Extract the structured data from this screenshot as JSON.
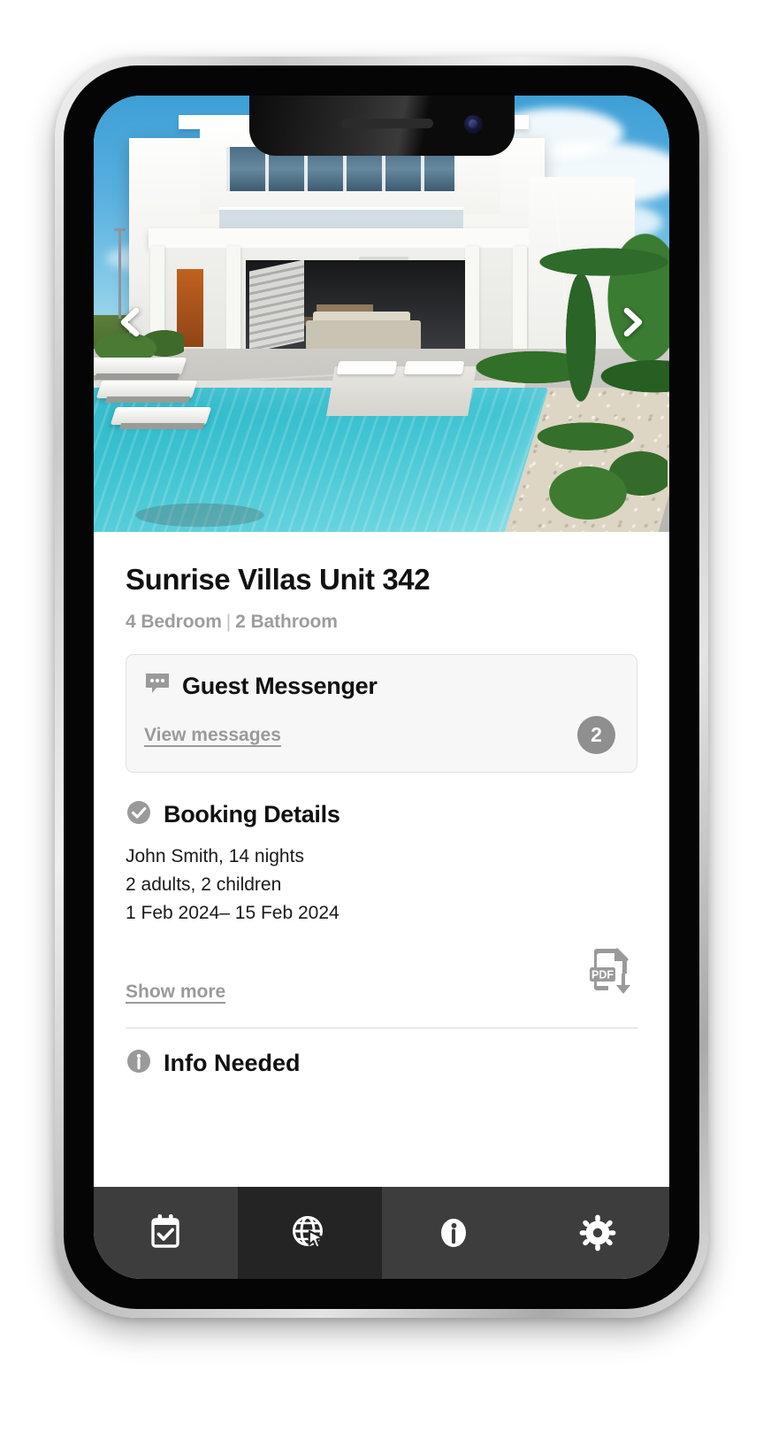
{
  "device": {
    "notch": {
      "speaker": "earpiece-speaker",
      "camera": "front-camera"
    }
  },
  "hero": {
    "alt": "modern white villa with swimming pool and loungers",
    "prev_arrow_icon": "chevron-left-icon",
    "next_arrow_icon": "chevron-right-icon"
  },
  "property": {
    "title": "Sunrise Villas Unit 342",
    "bedrooms": "4 Bedroom",
    "separator": "|",
    "bathrooms": "2 Bathroom"
  },
  "messenger": {
    "icon": "chat-bubble-icon",
    "title": "Guest Messenger",
    "link_label": "View messages",
    "unread_count": "2"
  },
  "booking": {
    "icon": "check-circle-icon",
    "title": "Booking Details",
    "lines": [
      "John Smith, 14 nights",
      "2 adults, 2 children",
      "1 Feb 2024– 15 Feb 2024"
    ],
    "show_more_label": "Show more",
    "pdf_icon": "pdf-download-icon",
    "pdf_label": "PDF"
  },
  "info_needed": {
    "icon": "info-circle-icon",
    "title": "Info Needed"
  },
  "bottom_nav": {
    "items": [
      {
        "name": "bookings",
        "icon": "calendar-check-icon",
        "active": false
      },
      {
        "name": "web",
        "icon": "globe-cursor-icon",
        "active": true
      },
      {
        "name": "info",
        "icon": "info-circle-icon",
        "active": false
      },
      {
        "name": "settings",
        "icon": "gear-icon",
        "active": false
      }
    ]
  },
  "colors": {
    "muted_gray": "#9a9a9a",
    "badge_gray": "#8f8f8f",
    "card_bg": "#f7f7f7",
    "card_border": "#e2e2e2",
    "nav_bg": "#3d3d3d",
    "nav_active_bg": "#242424",
    "text": "#111111"
  }
}
